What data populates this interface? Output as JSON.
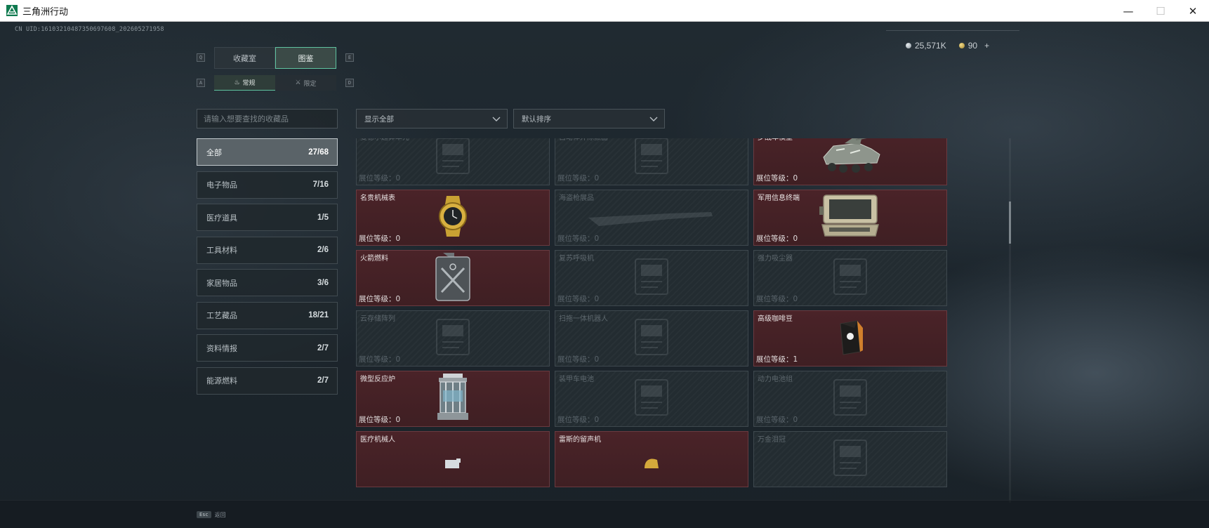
{
  "window": {
    "title": "三角洲行动",
    "controls": [
      "—",
      "☐",
      "✕"
    ]
  },
  "header": {
    "uid": "CN UID:16103210487350697608_202605271958",
    "currency": [
      {
        "icon": "silver-coin-icon",
        "value": "25,571K"
      },
      {
        "icon": "gold-coin-icon",
        "value": "90",
        "add": "+"
      }
    ]
  },
  "tabs": {
    "key_left": "Q",
    "key_right": "E",
    "items": [
      {
        "label": "收藏室",
        "active": false
      },
      {
        "label": "图鉴",
        "active": true
      }
    ]
  },
  "subtabs": {
    "key_left": "A",
    "key_right": "D",
    "items": [
      {
        "label": "常规",
        "icon": "flame-icon",
        "active": true
      },
      {
        "label": "限定",
        "icon": "crossed-swords-icon",
        "active": false
      }
    ]
  },
  "search": {
    "placeholder": "请输入想要查找的收藏品"
  },
  "filters": {
    "show": "显示全部",
    "sort": "默认排序"
  },
  "categories": [
    {
      "label": "全部",
      "count": "27/68",
      "active": true
    },
    {
      "label": "电子物品",
      "count": "7/16"
    },
    {
      "label": "医疗道具",
      "count": "1/5"
    },
    {
      "label": "工具材料",
      "count": "2/6"
    },
    {
      "label": "家居物品",
      "count": "3/6"
    },
    {
      "label": "工艺藏品",
      "count": "18/21"
    },
    {
      "label": "资料情报",
      "count": "2/7"
    },
    {
      "label": "能源燃料",
      "count": "2/7"
    }
  ],
  "level_label": "展位等级：",
  "items": [
    {
      "name": "曼德尔超算单元",
      "level": "0",
      "owned": false,
      "art": "device"
    },
    {
      "name": "自动体外除颤器",
      "level": "0",
      "owned": false,
      "art": "device"
    },
    {
      "name": "步战车模型",
      "level": "0",
      "owned": true,
      "art": "vehicle"
    },
    {
      "name": "名贵机械表",
      "level": "0",
      "owned": true,
      "art": "watch"
    },
    {
      "name": "海盗枪展品",
      "level": "0",
      "owned": false,
      "art": "gun"
    },
    {
      "name": "军用信息终端",
      "level": "0",
      "owned": true,
      "art": "terminal"
    },
    {
      "name": "火箭燃料",
      "level": "0",
      "owned": true,
      "art": "canister"
    },
    {
      "name": "复苏呼吸机",
      "level": "0",
      "owned": false,
      "art": "device"
    },
    {
      "name": "强力吸尘器",
      "level": "0",
      "owned": false,
      "art": "device"
    },
    {
      "name": "云存储阵列",
      "level": "0",
      "owned": false,
      "art": "device"
    },
    {
      "name": "扫拖一体机器人",
      "level": "0",
      "owned": false,
      "art": "device"
    },
    {
      "name": "高级咖啡豆",
      "level": "1",
      "owned": true,
      "art": "coffee"
    },
    {
      "name": "微型反应炉",
      "level": "0",
      "owned": true,
      "art": "reactor"
    },
    {
      "name": "装甲车电池",
      "level": "0",
      "owned": false,
      "art": "device"
    },
    {
      "name": "动力电池组",
      "level": "0",
      "owned": false,
      "art": "device"
    },
    {
      "name": "医疗机械人",
      "level": "",
      "owned": true,
      "art": "robot"
    },
    {
      "name": "雷斯的留声机",
      "level": "",
      "owned": true,
      "art": "phono"
    },
    {
      "name": "万金泪冠",
      "level": "",
      "owned": false,
      "art": "device"
    }
  ],
  "footer": {
    "key": "Esc",
    "label": "返回"
  },
  "colors": {
    "accent": "#5fc3a0",
    "owned_card": "#4a2328",
    "locked_card": "#232c31"
  }
}
